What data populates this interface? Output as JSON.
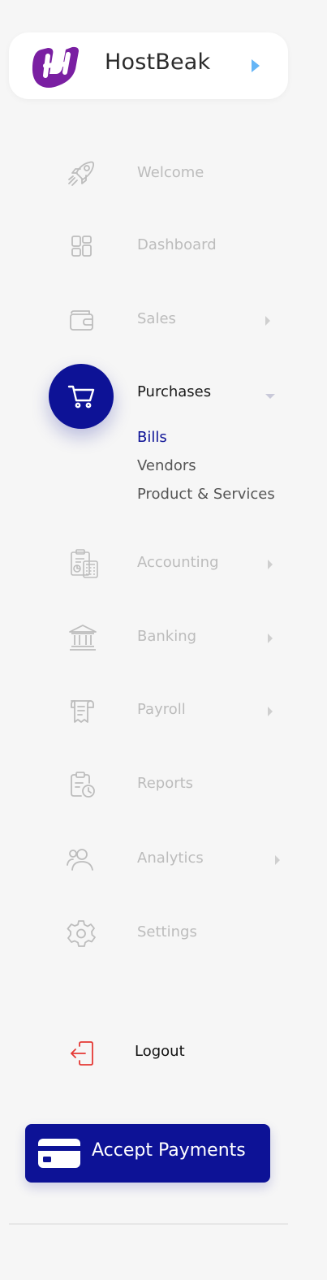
{
  "brand": {
    "name": "HostBeak",
    "logo_icon": "hostbeak-logo-icon",
    "accent": "#7a1fa2"
  },
  "nav": {
    "items": [
      {
        "label": "Welcome",
        "icon": "rocket-icon"
      },
      {
        "label": "Dashboard",
        "icon": "dashboard-icon"
      },
      {
        "label": "Sales",
        "icon": "wallet-icon",
        "has_submenu": true
      },
      {
        "label": "Purchases",
        "icon": "cart-icon",
        "active": true,
        "expanded": true
      },
      {
        "label": "Accounting",
        "icon": "accounting-icon",
        "has_submenu": true
      },
      {
        "label": "Banking",
        "icon": "bank-icon",
        "has_submenu": true
      },
      {
        "label": "Payroll",
        "icon": "receipt-icon",
        "has_submenu": true
      },
      {
        "label": "Reports",
        "icon": "report-icon"
      },
      {
        "label": "Analytics",
        "icon": "users-icon",
        "has_submenu": true
      },
      {
        "label": "Settings",
        "icon": "gear-icon"
      }
    ],
    "purchases_sub": [
      {
        "label": "Bills",
        "active": true
      },
      {
        "label": "Vendors"
      },
      {
        "label": "Product & Services"
      }
    ]
  },
  "logout": {
    "label": "Logout",
    "icon": "logout-icon"
  },
  "cta": {
    "label": "Accept Payments",
    "icon": "credit-card-icon"
  },
  "colors": {
    "primary": "#0d1296",
    "inactive": "#bcbcbc",
    "logout_icon": "#e53935",
    "expand_arrow": "#64b5f6"
  }
}
